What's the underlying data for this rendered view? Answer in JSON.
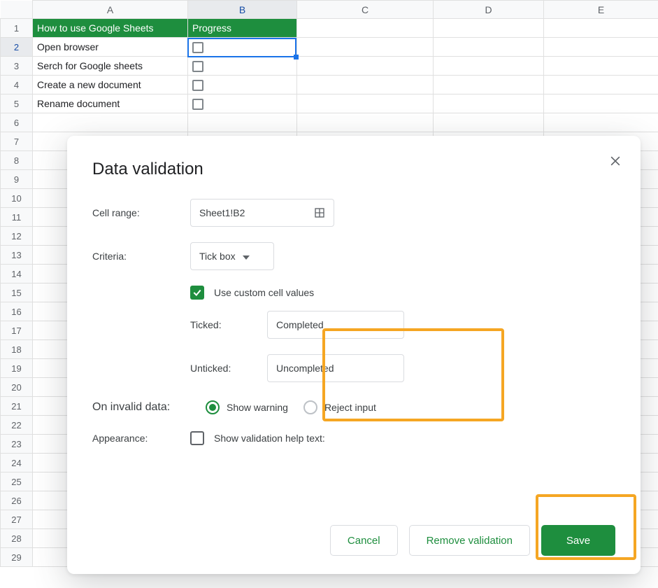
{
  "sheet": {
    "columns": [
      "A",
      "B",
      "C",
      "D",
      "E"
    ],
    "row_numbers": [
      1,
      2,
      3,
      4,
      5,
      6,
      7,
      8,
      9,
      10,
      11,
      12,
      13,
      14,
      15,
      16,
      17,
      18,
      19,
      20,
      21,
      22,
      23,
      24,
      25,
      26,
      27,
      28,
      29
    ],
    "header": {
      "A1": "How to use Google Sheets",
      "B1": "Progress"
    },
    "rows": {
      "A2": "Open browser",
      "A3": "Serch for Google sheets",
      "A4": "Create a new document",
      "A5": "Rename document"
    },
    "selected_cell": "B2"
  },
  "dialog": {
    "title": "Data validation",
    "labels": {
      "cell_range": "Cell range:",
      "criteria": "Criteria:",
      "use_custom": "Use custom cell values",
      "ticked": "Ticked:",
      "unticked": "Unticked:",
      "on_invalid": "On invalid data:",
      "show_warning": "Show warning",
      "reject_input": "Reject input",
      "appearance": "Appearance:",
      "help_text": "Show validation help text:"
    },
    "values": {
      "cell_range": "Sheet1!B2",
      "criteria": "Tick box",
      "use_custom_checked": true,
      "ticked": "Completed",
      "unticked": "Uncompleted",
      "invalid_selected": "show_warning"
    },
    "buttons": {
      "cancel": "Cancel",
      "remove": "Remove validation",
      "save": "Save"
    }
  }
}
